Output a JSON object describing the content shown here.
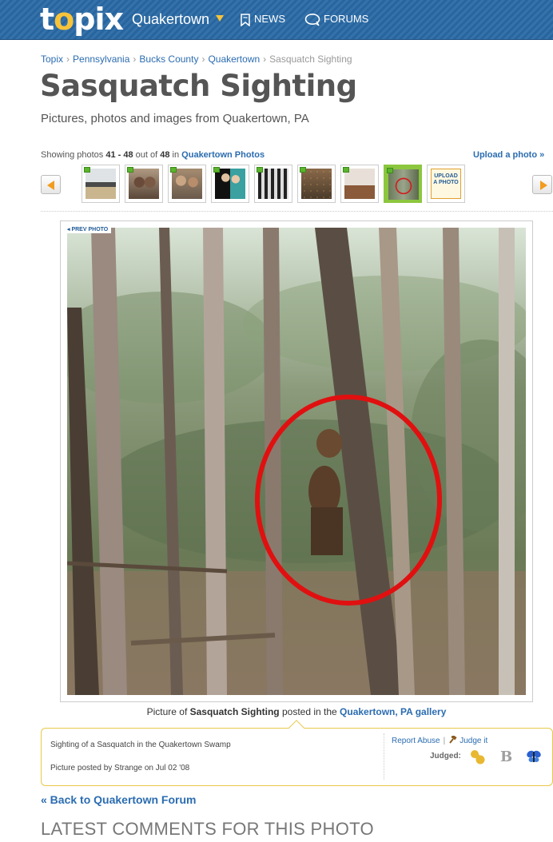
{
  "header": {
    "logo_pre": "t",
    "logo_dot": "o",
    "logo_post": "pix",
    "city": "Quakertown",
    "nav_news": "NEWS",
    "nav_forums": "FORUMS"
  },
  "breadcrumb": {
    "items": [
      "Topix",
      "Pennsylvania",
      "Bucks County",
      "Quakertown"
    ],
    "current": "Sasquatch Sighting",
    "separator": "›"
  },
  "page": {
    "title": "Sasquatch Sighting",
    "subtitle": "Pictures, photos and images from Quakertown, PA"
  },
  "gallery": {
    "showing_prefix": "Showing photos ",
    "range": "41 - 48",
    "out_of": " out of ",
    "total": "48",
    "in": " in ",
    "gallery_link": "Quakertown Photos",
    "upload_link": "Upload a photo »",
    "upload_thumb_label": "UPLOAD A PHOTO",
    "thumb_count": 8,
    "active_thumb": 8
  },
  "photo": {
    "prev_label": "◂ PREV PHOTO",
    "caption_prefix": "Picture of ",
    "caption_title": "Sasquatch Sighting",
    "caption_mid": " posted in the ",
    "caption_link": "Quakertown, PA gallery"
  },
  "info": {
    "description": "Sighting of a Sasquatch in the Quakertown Swamp",
    "posted_by": "Picture posted by Strange on Jul 02 '08",
    "report_abuse": "Report Abuse",
    "judge_it": "Judge it",
    "judged_label": "Judged:"
  },
  "footer": {
    "back_link": "« Back to Quakertown Forum",
    "latest_heading": "LATEST COMMENTS FOR THIS PHOTO"
  },
  "colors": {
    "header_bg": "#2a6aa6",
    "link": "#2b6cb0",
    "accent_orange": "#f29b1d",
    "active_thumb": "#8cc63f",
    "circle": "#e01010"
  }
}
